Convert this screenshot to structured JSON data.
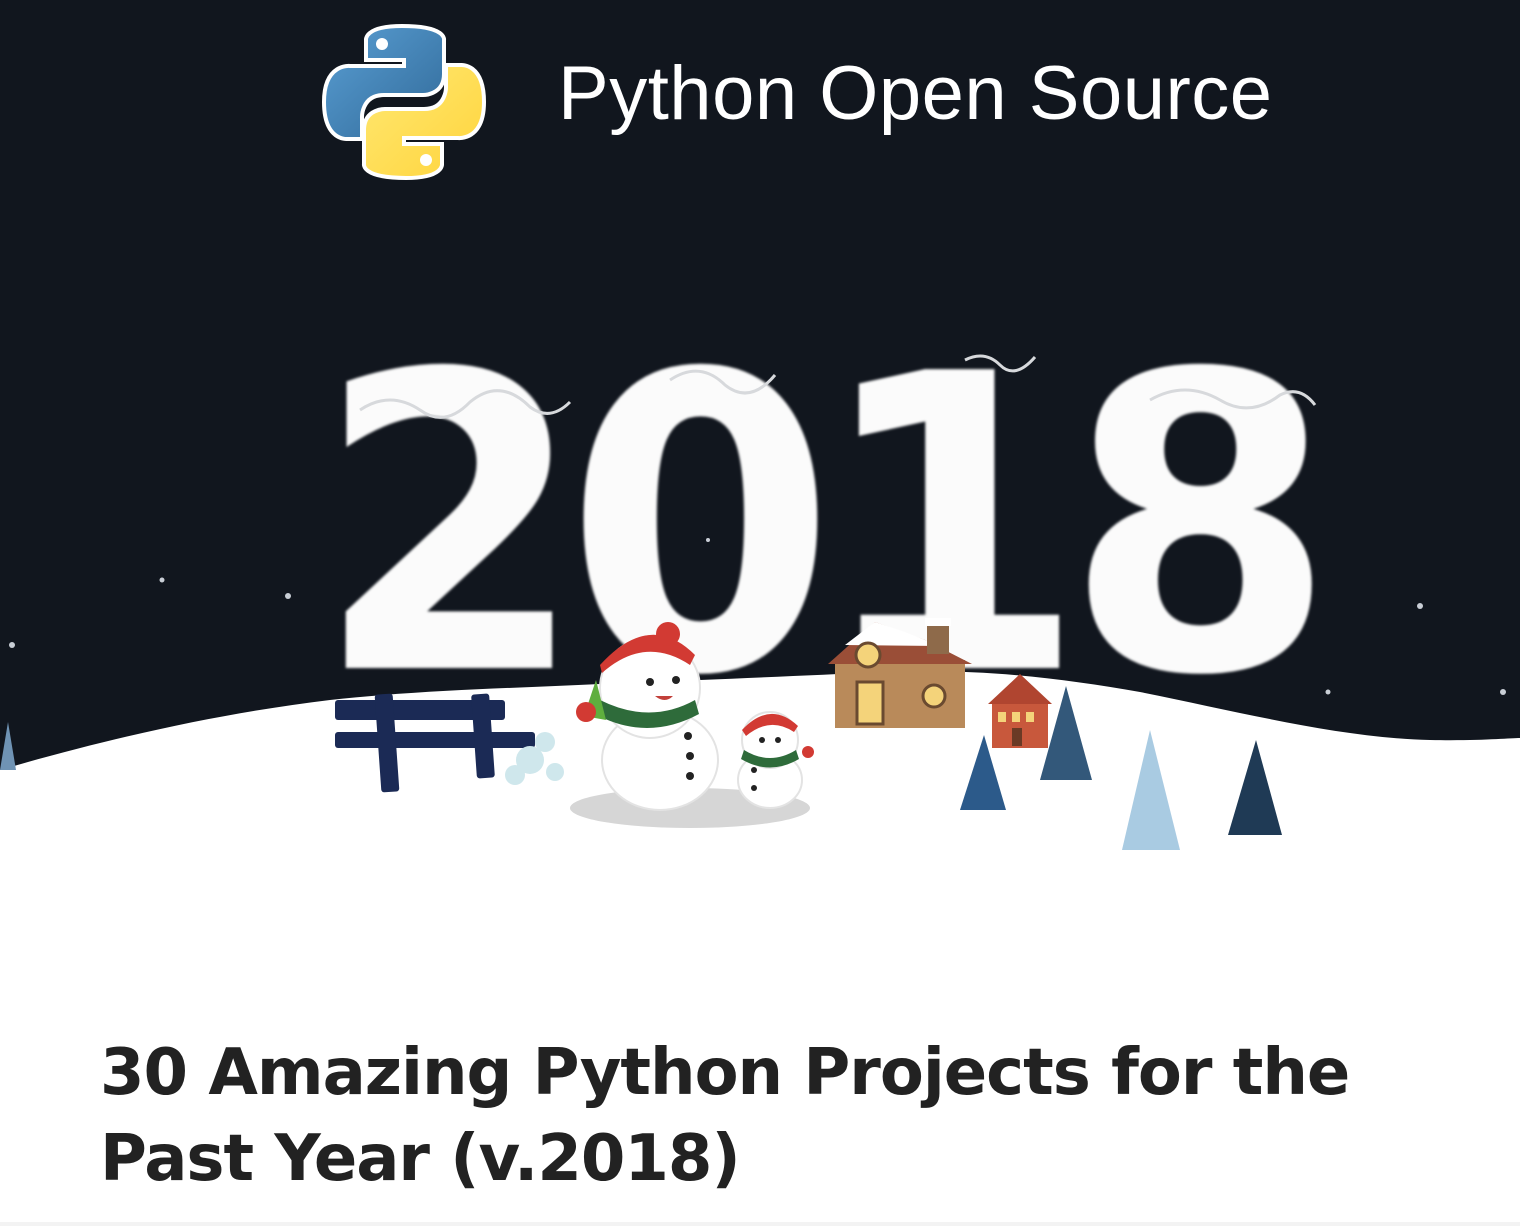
{
  "brand": {
    "name": "Python Open Source",
    "logo_icon": "python-logo-icon"
  },
  "hero": {
    "year_text": "2018",
    "background_color": "#11161e",
    "snow_color": "#ffffff"
  },
  "article": {
    "title": "30 Amazing Python Projects for the Past Year (v.2018)",
    "title_color": "#222222"
  }
}
